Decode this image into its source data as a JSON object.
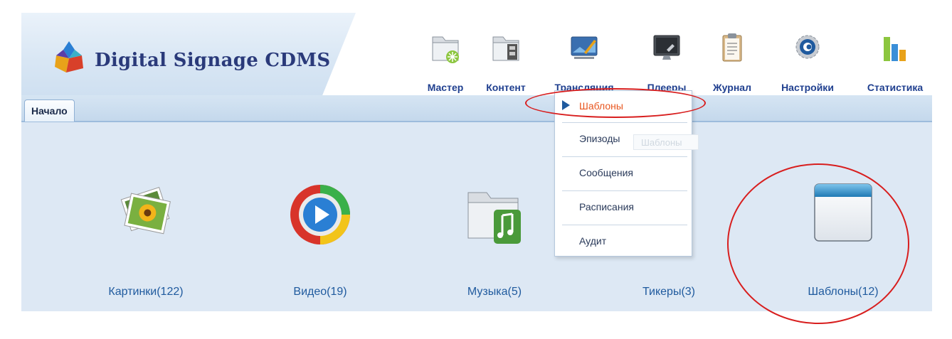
{
  "app": {
    "title": "Digital Signage CDMS"
  },
  "nav": {
    "items": [
      {
        "label": "Мастер",
        "icon": "wizard-folder-icon"
      },
      {
        "label": "Контент",
        "icon": "content-folder-icon"
      },
      {
        "label": "Трансляция",
        "icon": "broadcast-screen-icon"
      },
      {
        "label": "Плееры",
        "icon": "player-monitor-icon"
      },
      {
        "label": "Журнал",
        "icon": "journal-clipboard-icon"
      },
      {
        "label": "Настройки",
        "icon": "settings-gear-icon"
      },
      {
        "label": "Статистика",
        "icon": "statistics-bars-icon"
      }
    ]
  },
  "tabs": [
    {
      "label": "Начало"
    }
  ],
  "dropdown": {
    "items": [
      {
        "label": "Шаблоны",
        "active": true
      },
      {
        "label": "Эпизоды"
      },
      {
        "label": "Сообщения"
      },
      {
        "label": "Расписания"
      },
      {
        "label": "Аудит"
      }
    ],
    "ghost_tooltip": "Шаблоны"
  },
  "tiles": [
    {
      "label": "Картинки(122)",
      "icon": "pictures-icon"
    },
    {
      "label": "Видео(19)",
      "icon": "video-play-icon"
    },
    {
      "label": "Музыка(5)",
      "icon": "music-folder-icon"
    },
    {
      "label": "Тикеры(3)",
      "icon": "ticker-icon"
    },
    {
      "label": "Шаблоны(12)",
      "icon": "template-window-icon"
    }
  ],
  "colors": {
    "accent": "#1f5a9e",
    "active_menu": "#e8551e",
    "annotation": "#d81e1e",
    "title": "#2a3a7a"
  }
}
